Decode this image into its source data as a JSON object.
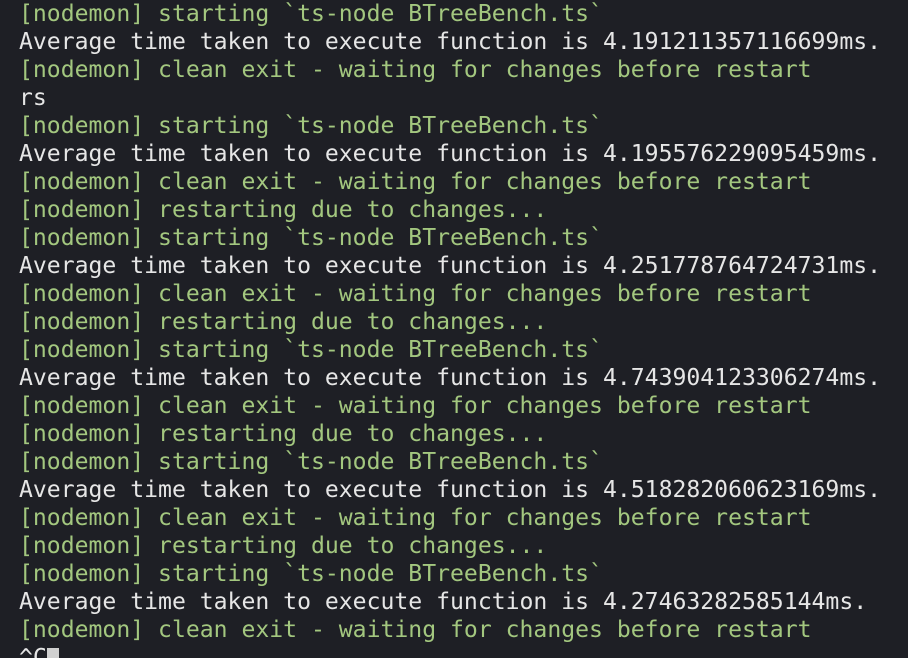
{
  "terminal": {
    "lines": [
      {
        "text": "[nodemon] starting `ts-node BTreeBench.ts`",
        "kind": "nodemon"
      },
      {
        "text": "Average time taken to execute function is 4.191211357116699ms.",
        "kind": "output"
      },
      {
        "text": "[nodemon] clean exit - waiting for changes before restart",
        "kind": "nodemon"
      },
      {
        "text": "rs",
        "kind": "output"
      },
      {
        "text": "[nodemon] starting `ts-node BTreeBench.ts`",
        "kind": "nodemon"
      },
      {
        "text": "Average time taken to execute function is 4.195576229095459ms.",
        "kind": "output"
      },
      {
        "text": "[nodemon] clean exit - waiting for changes before restart",
        "kind": "nodemon"
      },
      {
        "text": "[nodemon] restarting due to changes...",
        "kind": "nodemon"
      },
      {
        "text": "[nodemon] starting `ts-node BTreeBench.ts`",
        "kind": "nodemon"
      },
      {
        "text": "Average time taken to execute function is 4.251778764724731ms.",
        "kind": "output"
      },
      {
        "text": "[nodemon] clean exit - waiting for changes before restart",
        "kind": "nodemon"
      },
      {
        "text": "[nodemon] restarting due to changes...",
        "kind": "nodemon"
      },
      {
        "text": "[nodemon] starting `ts-node BTreeBench.ts`",
        "kind": "nodemon"
      },
      {
        "text": "Average time taken to execute function is 4.743904123306274ms.",
        "kind": "output"
      },
      {
        "text": "[nodemon] clean exit - waiting for changes before restart",
        "kind": "nodemon"
      },
      {
        "text": "[nodemon] restarting due to changes...",
        "kind": "nodemon"
      },
      {
        "text": "[nodemon] starting `ts-node BTreeBench.ts`",
        "kind": "nodemon"
      },
      {
        "text": "Average time taken to execute function is 4.518282060623169ms.",
        "kind": "output"
      },
      {
        "text": "[nodemon] clean exit - waiting for changes before restart",
        "kind": "nodemon"
      },
      {
        "text": "[nodemon] restarting due to changes...",
        "kind": "nodemon"
      },
      {
        "text": "[nodemon] starting `ts-node BTreeBench.ts`",
        "kind": "nodemon"
      },
      {
        "text": "Average time taken to execute function is 4.27463282585144ms.",
        "kind": "output"
      },
      {
        "text": "[nodemon] clean exit - waiting for changes before restart",
        "kind": "nodemon"
      }
    ],
    "prompt_text": "^C",
    "colors": {
      "background": "#1e1f25",
      "nodemon_text": "#a3c77f",
      "output_text": "#e6e6e6",
      "cursor": "#d0d0d0"
    }
  }
}
